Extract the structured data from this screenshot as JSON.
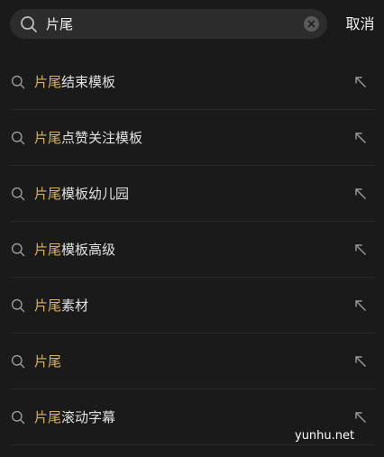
{
  "search": {
    "value": "片尾",
    "cancel_label": "取消"
  },
  "suggestions": [
    {
      "highlight": "片尾",
      "rest": "结束模板"
    },
    {
      "highlight": "片尾",
      "rest": "点赞关注模板"
    },
    {
      "highlight": "片尾",
      "rest": "模板幼儿园"
    },
    {
      "highlight": "片尾",
      "rest": "模板高级"
    },
    {
      "highlight": "片尾",
      "rest": "素材"
    },
    {
      "highlight": "片尾",
      "rest": ""
    },
    {
      "highlight": "片尾",
      "rest": "滚动字幕"
    }
  ],
  "watermark": "yunhu.net",
  "colors": {
    "background": "#1a1a1a",
    "search_field": "#2c2c2c",
    "highlight": "#d8b25e",
    "text": "#e2e2e2"
  },
  "icons": {
    "search": "search-icon",
    "clear": "clear-icon",
    "fill": "arrow-up-left-icon"
  }
}
